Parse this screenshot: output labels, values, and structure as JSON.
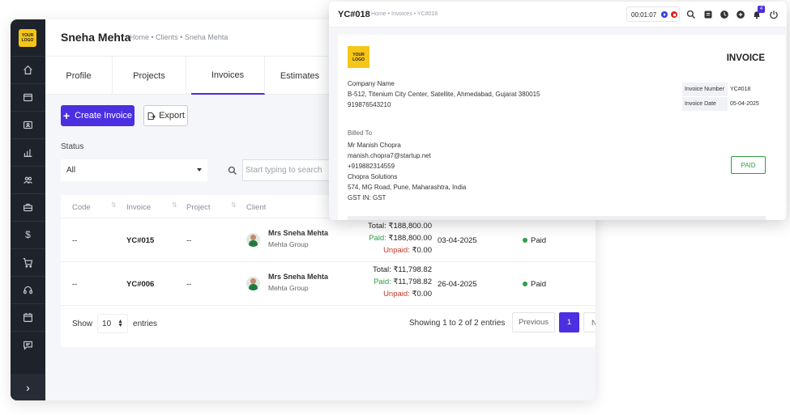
{
  "sidebar": {
    "logo_text": "YOUR LOGO",
    "items": [
      {
        "icon": "home-icon"
      },
      {
        "icon": "browser-icon"
      },
      {
        "icon": "id-card-icon"
      },
      {
        "icon": "chart-icon"
      },
      {
        "icon": "users-icon"
      },
      {
        "icon": "briefcase-icon"
      },
      {
        "icon": "dollar-icon"
      },
      {
        "icon": "cart-icon"
      },
      {
        "icon": "headset-icon"
      },
      {
        "icon": "calendar-icon"
      },
      {
        "icon": "message-icon"
      }
    ],
    "toggle_glyph": "›"
  },
  "header": {
    "title": "Sneha Mehta",
    "breadcrumb": "Home • Clients • Sneha Mehta"
  },
  "tabs": [
    {
      "label": "Profile"
    },
    {
      "label": "Projects"
    },
    {
      "label": "Invoices",
      "active": true
    },
    {
      "label": "Estimates"
    }
  ],
  "toolbar": {
    "create_label": "Create Invoice",
    "export_label": "Export"
  },
  "filters": {
    "status_label": "Status",
    "status_value": "All",
    "search_placeholder": "Start typing to search"
  },
  "table": {
    "columns": [
      "Code",
      "Invoice",
      "Project",
      "Client"
    ],
    "rows": [
      {
        "code": "--",
        "invoice": "YC#015",
        "project": "--",
        "client_name": "Mrs Sneha Mehta",
        "client_org": "Mehta Group",
        "total_label": "Total:",
        "total": "₹188,800.00",
        "paid_label": "Paid:",
        "paid": "₹188,800.00",
        "unpaid_label": "Unpaid:",
        "unpaid": "₹0.00",
        "date": "03-04-2025",
        "status": "Paid"
      },
      {
        "code": "--",
        "invoice": "YC#006",
        "project": "--",
        "client_name": "Mrs Sneha Mehta",
        "client_org": "Mehta Group",
        "total_label": "Total:",
        "total": "₹11,798.82",
        "paid_label": "Paid:",
        "paid": "₹11,798.82",
        "unpaid_label": "Unpaid:",
        "unpaid": "₹0.00",
        "date": "26-04-2025",
        "status": "Paid"
      }
    ],
    "show_label": "Show",
    "entries_value": "10",
    "entries_label": "entries",
    "showing_text": "Showing 1 to 2 of 2 entries",
    "prev_label": "Previous",
    "page_current": "1",
    "next_label": "N"
  },
  "invoice_window": {
    "title": "YC#018",
    "breadcrumb": "Home • Invoices • YC#018",
    "timer": "00:01:07",
    "notification_count": "4",
    "logo_text": "YOUR LOGO",
    "heading": "INVOICE",
    "company": {
      "name": "Company Name",
      "address": "B-512, Titenium City Center, Satellite, Ahmedabad, Gujarat 380015",
      "phone": "919876543210"
    },
    "meta": {
      "number_label": "Invoice Number",
      "number": "YC#018",
      "date_label": "Invoice Date",
      "date": "05-04-2025"
    },
    "billed_to_label": "Billed To",
    "billed_to": {
      "name": "Mr Manish Chopra",
      "email": "manish.chopra7@startup.net",
      "phone": "+919882314559",
      "company": "Chopra Solutions",
      "address": "574, MG Road, Pune, Maharashtra, India",
      "gst": "GST IN: GST"
    },
    "status": "PAID"
  },
  "colors": {
    "accent": "#4b2fe0",
    "sidebar": "#1e222b",
    "paid": "#2e9e44",
    "unpaid": "#c0392b",
    "logo": "#f5c518"
  }
}
